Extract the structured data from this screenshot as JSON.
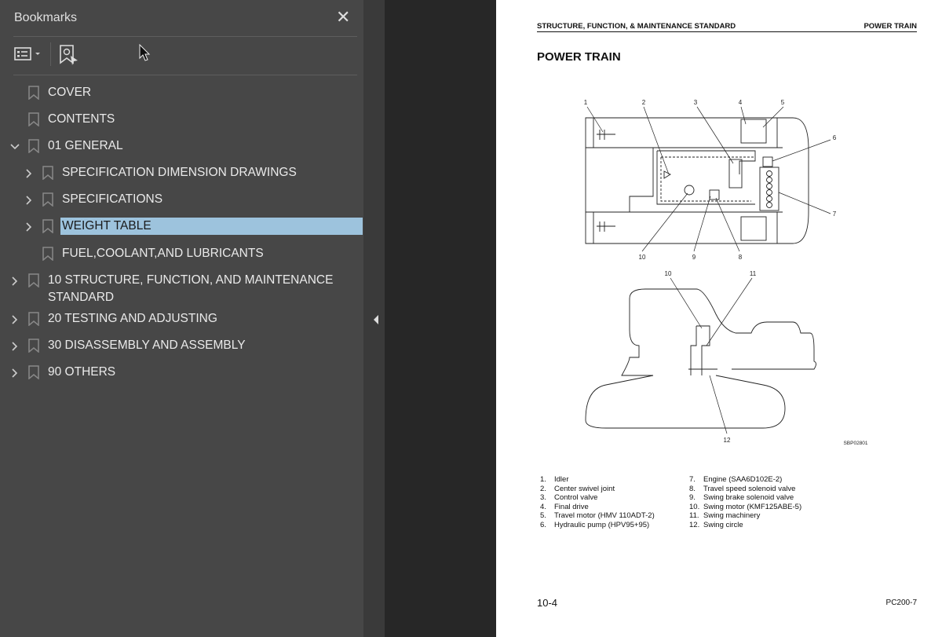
{
  "bookmarks": {
    "title": "Bookmarks",
    "close_icon": "close-icon",
    "toolbar": {
      "options_icon": "list-options-icon",
      "find_icon": "find-current-bookmark-icon"
    },
    "items": [
      {
        "label": "COVER",
        "level": 0,
        "expander": "none"
      },
      {
        "label": "CONTENTS",
        "level": 0,
        "expander": "none"
      },
      {
        "label": "01 GENERAL",
        "level": 0,
        "expander": "expanded"
      },
      {
        "label": "SPECIFICATION DIMENSION DRAWINGS",
        "level": 1,
        "expander": "collapsed"
      },
      {
        "label": "SPECIFICATIONS",
        "level": 1,
        "expander": "collapsed"
      },
      {
        "label": "WEIGHT TABLE",
        "level": 1,
        "expander": "collapsed",
        "selected": true
      },
      {
        "label": "FUEL,COOLANT,AND LUBRICANTS",
        "level": 1,
        "expander": "none"
      },
      {
        "label": "10 STRUCTURE, FUNCTION, AND MAINTENANCE",
        "label2": "STANDARD",
        "level": 0,
        "expander": "collapsed"
      },
      {
        "label": "20 TESTING AND ADJUSTING",
        "level": 0,
        "expander": "collapsed"
      },
      {
        "label": "30 DISASSEMBLY AND ASSEMBLY",
        "level": 0,
        "expander": "collapsed"
      },
      {
        "label": "90 OTHERS",
        "level": 0,
        "expander": "collapsed"
      }
    ],
    "selection_color": "#9dc3dd"
  },
  "page": {
    "header_left": "STRUCTURE, FUNCTION, & MAINTENANCE STANDARD",
    "header_right": "POWER TRAIN",
    "title": "POWER TRAIN",
    "figure_code": "SBP02801",
    "callouts": [
      "1",
      "2",
      "3",
      "4",
      "5",
      "6",
      "7",
      "8",
      "9",
      "10",
      "11",
      "12"
    ],
    "legend_left": [
      {
        "n": "1.",
        "t": "Idler"
      },
      {
        "n": "2.",
        "t": "Center swivel joint"
      },
      {
        "n": "3.",
        "t": "Control valve"
      },
      {
        "n": "4.",
        "t": "Final drive"
      },
      {
        "n": "5.",
        "t": "Travel motor (HMV 110ADT-2)"
      },
      {
        "n": "6.",
        "t": "Hydraulic pump (HPV95+95)"
      }
    ],
    "legend_right": [
      {
        "n": "7.",
        "t": "Engine (SAA6D102E-2)"
      },
      {
        "n": "8.",
        "t": "Travel speed solenoid valve"
      },
      {
        "n": "9.",
        "t": "Swing brake solenoid valve"
      },
      {
        "n": "10.",
        "t": "Swing motor (KMF125ABE-5)"
      },
      {
        "n": "11.",
        "t": "Swing machinery"
      },
      {
        "n": "12.",
        "t": "Swing circle"
      }
    ],
    "page_number": "10-4",
    "model": "PC200-7"
  }
}
